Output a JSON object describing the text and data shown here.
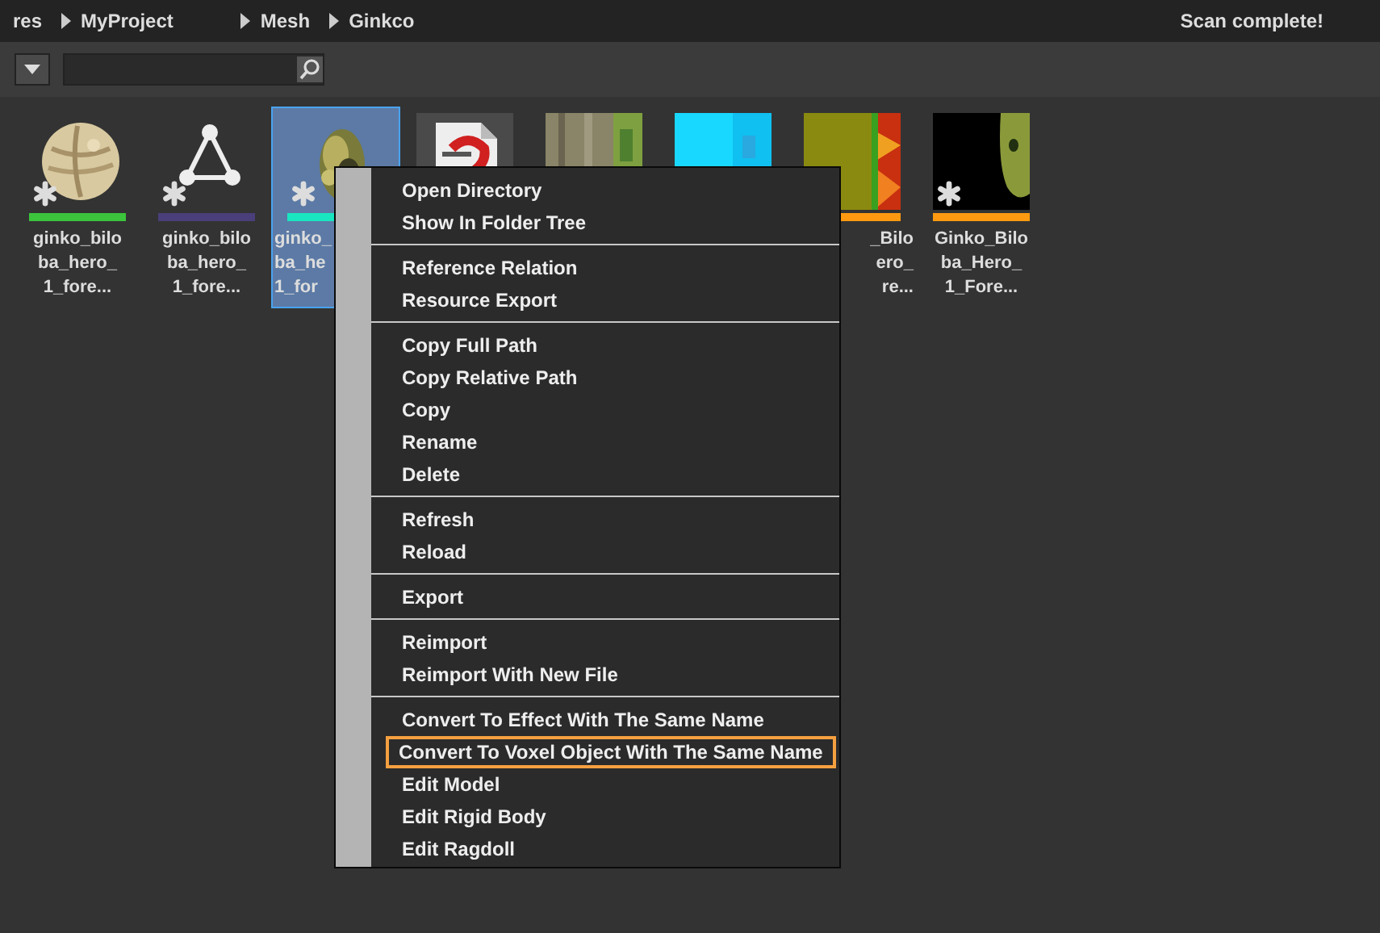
{
  "breadcrumb": [
    "res",
    "MyProject",
    "Mesh",
    "Ginkco"
  ],
  "status": "Scan complete!",
  "assets": [
    {
      "kind": "sphere",
      "color": "#3cc43c",
      "starred": true,
      "selected": false,
      "label": [
        "ginko_bilo",
        "ba_hero_",
        "1_fore..."
      ]
    },
    {
      "kind": "graph",
      "color": "#4a3f7a",
      "starred": true,
      "selected": false,
      "label": [
        "ginko_bilo",
        "ba_hero_",
        "1_fore..."
      ]
    },
    {
      "kind": "tree",
      "color": "#19e6c0",
      "starred": true,
      "selected": true,
      "cut_right": true,
      "label": [
        "ginko_",
        "ba_he",
        "1_for"
      ]
    },
    {
      "kind": "doc",
      "selected": false,
      "cut_below": true
    },
    {
      "kind": "bark",
      "selected": false,
      "cut_below": true
    },
    {
      "kind": "cyan",
      "selected": false,
      "cut_below": true
    },
    {
      "kind": "leaf",
      "color": "#ff9a10",
      "selected": false,
      "cut_left": true,
      "label": [
        "_Bilo",
        "ero_",
        "re..."
      ]
    },
    {
      "kind": "dark",
      "color": "#ff9a10",
      "starred": true,
      "selected": false,
      "label": [
        "Ginko_Bilo",
        "ba_Hero_",
        "1_Fore..."
      ]
    }
  ],
  "menu": {
    "groups": [
      [
        {
          "label": "Open Directory",
          "highlighted": false
        },
        {
          "label": "Show In Folder Tree",
          "highlighted": false
        }
      ],
      [
        {
          "label": "Reference Relation",
          "highlighted": false
        },
        {
          "label": "Resource Export",
          "highlighted": false
        }
      ],
      [
        {
          "label": "Copy Full Path",
          "highlighted": false
        },
        {
          "label": "Copy Relative Path",
          "highlighted": false
        },
        {
          "label": "Copy",
          "highlighted": false
        },
        {
          "label": "Rename",
          "highlighted": false
        },
        {
          "label": "Delete",
          "highlighted": false
        }
      ],
      [
        {
          "label": "Refresh",
          "highlighted": false
        },
        {
          "label": "Reload",
          "highlighted": false
        }
      ],
      [
        {
          "label": "Export",
          "highlighted": false
        }
      ],
      [
        {
          "label": "Reimport",
          "highlighted": false
        },
        {
          "label": "Reimport With New File",
          "highlighted": false
        }
      ],
      [
        {
          "label": "Convert To Effect With The Same Name",
          "highlighted": false
        },
        {
          "label": "Convert To Voxel Object With The Same Name",
          "highlighted": true
        },
        {
          "label": "Edit Model",
          "highlighted": false
        },
        {
          "label": "Edit Rigid Body",
          "highlighted": false
        },
        {
          "label": "Edit Ragdoll",
          "highlighted": false
        }
      ]
    ]
  }
}
